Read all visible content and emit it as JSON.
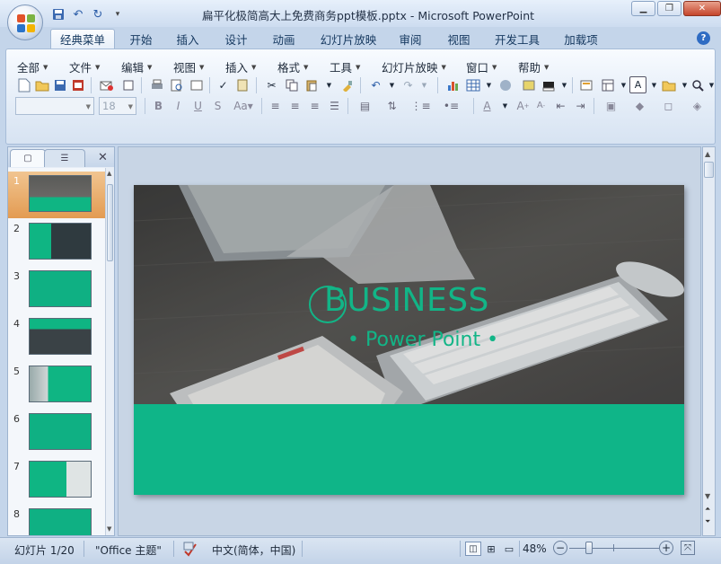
{
  "window": {
    "title": "扁平化极简高大上免费商务ppt模板.pptx - Microsoft PowerPoint"
  },
  "ribbon_tabs": [
    "经典菜单",
    "开始",
    "插入",
    "设计",
    "动画",
    "幻灯片放映",
    "审阅",
    "视图",
    "开发工具",
    "加载项"
  ],
  "classic_menus": [
    "全部",
    "文件",
    "编辑",
    "视图",
    "插入",
    "格式",
    "工具",
    "幻灯片放映",
    "窗口",
    "帮助"
  ],
  "font_size_combo": "18",
  "slides_pane": {
    "slide_numbers": [
      "1",
      "2",
      "3",
      "4",
      "5",
      "6",
      "7",
      "8"
    ],
    "selected": "1"
  },
  "slide": {
    "title": "BUSINESS",
    "subtitle": "•  Power Point  •"
  },
  "status_bar": {
    "slide_info": "幻灯片 1/20",
    "theme": "\"Office 主题\"",
    "language": "中文(简体，中国)",
    "zoom": "48%"
  },
  "colors": {
    "accent_green": "#0fb588",
    "ribbon_blue": "#dfe9f5"
  }
}
